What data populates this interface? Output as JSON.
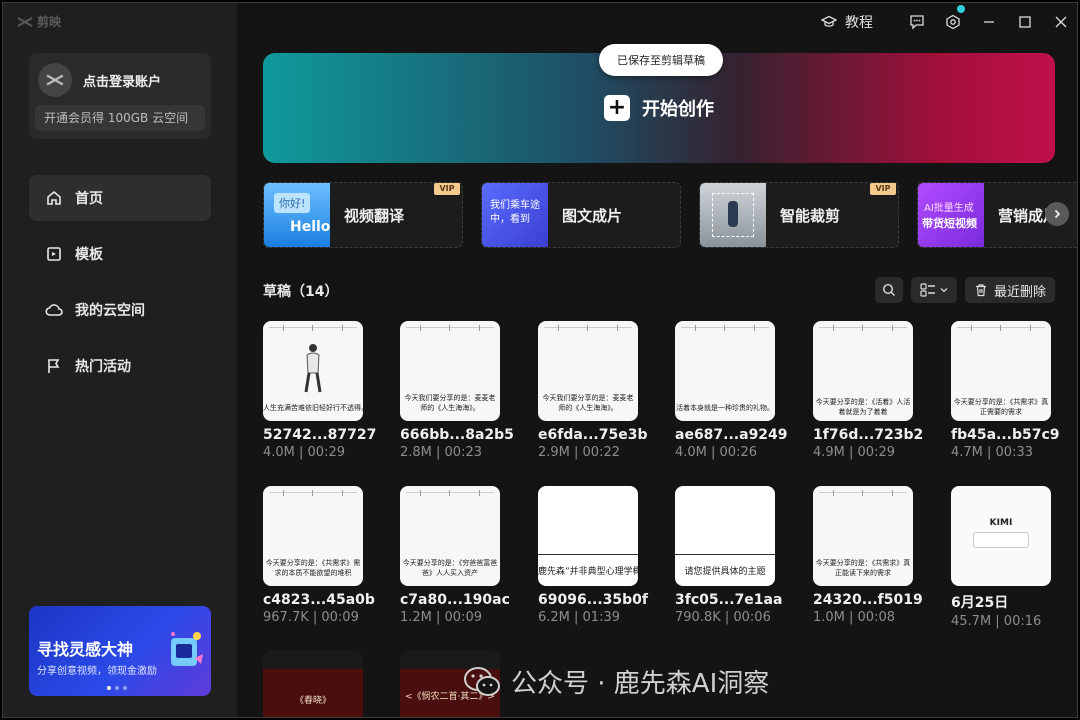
{
  "app": {
    "logo_text": "剪映"
  },
  "account": {
    "login_label": "点击登录账户",
    "member_promo": "开通会员得 100GB 云空间"
  },
  "nav": [
    {
      "label": "首页",
      "icon": "home-icon",
      "active": true
    },
    {
      "label": "模板",
      "icon": "template-icon",
      "active": false
    },
    {
      "label": "我的云空间",
      "icon": "cloud-icon",
      "active": false
    },
    {
      "label": "热门活动",
      "icon": "flag-icon",
      "active": false
    }
  ],
  "promo": {
    "title": "寻找灵感大神",
    "subtitle": "分享创意视频，领现金激励"
  },
  "titlebar": {
    "tutorial_label": "教程"
  },
  "hero": {
    "label": "开始创作",
    "toast": "已保存至剪辑草稿"
  },
  "features": [
    {
      "label": "视频翻译",
      "vip": "VIP",
      "thumb_text_1": "你好!",
      "thumb_text_2": "Hello"
    },
    {
      "label": "图文成片",
      "vip": "",
      "thumb_text_1": "我们乘车途中，看到",
      "thumb_text_2": ""
    },
    {
      "label": "智能裁剪",
      "vip": "VIP",
      "thumb_text_1": "",
      "thumb_text_2": ""
    },
    {
      "label": "营销成片",
      "vip": "",
      "thumb_text_1": "AI批量生成",
      "thumb_text_2": "带货短视频"
    }
  ],
  "drafts": {
    "title": "草稿（14）",
    "trash_label": "最近删除",
    "items": [
      {
        "name": "52742...87727",
        "meta": "4.0M | 00:29",
        "caption": "人生充满苦难依旧轻好行不透得。"
      },
      {
        "name": "666bb...8a2b5",
        "meta": "2.8M | 00:23",
        "caption": "今天我们要分享的是：麦麦老师的《人生海海》。"
      },
      {
        "name": "e6fda...75e3b",
        "meta": "2.9M | 00:22",
        "caption": "今天我们要分享的是：麦麦老师的《人生海海》。"
      },
      {
        "name": "ae687...a9249",
        "meta": "4.0M | 00:26",
        "caption": "活着本身就是一种珍贵的礼物。"
      },
      {
        "name": "1f76d...723b2",
        "meta": "4.9M | 00:29",
        "caption": "今天要分享的是：《活着》人活着就是为了着着"
      },
      {
        "name": "fb45a...b57c9",
        "meta": "4.7M | 00:33",
        "caption": "今天要分享的是：《共需求》真正需要的需求"
      },
      {
        "name": "c4823...45a0b",
        "meta": "967.7K | 00:09",
        "caption": "今天要分享的是：《共需求》需求的本质不能欲望的堆积"
      },
      {
        "name": "c7a80...190ac",
        "meta": "1.2M | 00:09",
        "caption": "今天要分享的是：《穷爸爸富爸爸》人人买入资产"
      },
      {
        "name": "69096...35b0f",
        "meta": "6.2M | 01:39",
        "caption": "鹿先森”并非典型心理学概"
      },
      {
        "name": "3fc05...7e1aa",
        "meta": "790.8K | 00:06",
        "caption": "请您提供具体的主题"
      },
      {
        "name": "24320...f5019",
        "meta": "1.0M | 00:08",
        "caption": "今天要分享的是：《共需求》真正能读下来的需求"
      },
      {
        "name": "6月25日",
        "meta": "45.7M | 00:16",
        "caption": "KIMI"
      },
      {
        "name": "",
        "meta": "",
        "caption": "《春晓》"
      },
      {
        "name": "",
        "meta": "",
        "caption": "<《悯农二首·其二》>"
      }
    ]
  },
  "watermark": "公众号 · 鹿先森AI洞察",
  "colors": {
    "accent_teal": "#0f9a9b",
    "accent_red": "#c0104a",
    "vip_gold": "#f3c98d",
    "notify_dot": "#33d0e0"
  }
}
